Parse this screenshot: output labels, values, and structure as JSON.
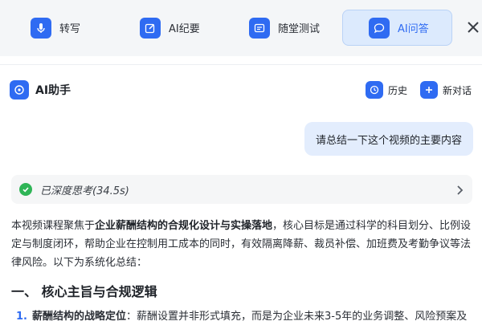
{
  "tabs": [
    {
      "label": "转写",
      "icon": "microphone-icon"
    },
    {
      "label": "AI纪要",
      "icon": "edit-icon"
    },
    {
      "label": "随堂测试",
      "icon": "quiz-icon"
    },
    {
      "label": "AI问答",
      "icon": "chat-bubble-icon",
      "active": true
    }
  ],
  "assistant": {
    "title": "AI助手",
    "history_label": "历史",
    "new_chat_label": "新对话"
  },
  "conversation": {
    "user_message": "请总结一下这个视频的主要内容",
    "thinking_status": "已深度思考(34.5s)",
    "answer": {
      "intro_prefix": "本视频课程聚焦于",
      "intro_bold": "企业薪酬结构的合规化设计与实操落地",
      "intro_rest": "，核心目标是通过科学的科目划分、比例设定与制度闭环，帮助企业在控制用工成本的同时，有效隔离降薪、裁员补偿、加班费及考勤争议等法律风险。以下为系统化总结：",
      "section_heading": "一、 核心主旨与合规逻辑",
      "items": [
        {
          "number": "1.",
          "title": "薪酬结构的战略定位",
          "text": "：薪酬设置并非形式填充，而是为企业未来3-5年的业务调整、风险预案及"
        }
      ]
    }
  },
  "colors": {
    "accent": "#2f6bf2",
    "active_tab_bg": "#dceafd",
    "user_bubble_bg": "#e3edfd",
    "success": "#2fb557"
  }
}
